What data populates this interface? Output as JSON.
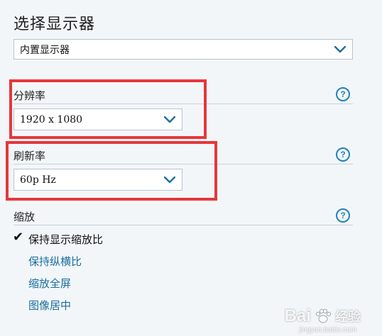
{
  "page": {
    "title": "选择显示器"
  },
  "display_select": {
    "value": "内置显示器"
  },
  "resolution": {
    "label": "分辨率",
    "value": "1920 x 1080"
  },
  "refresh_rate": {
    "label": "刷新率",
    "value": "60p Hz"
  },
  "scaling": {
    "label": "缩放",
    "options": [
      {
        "label": "保持显示缩放比",
        "selected": true
      },
      {
        "label": "保持纵横比",
        "selected": false
      },
      {
        "label": "缩放全屏",
        "selected": false
      },
      {
        "label": "图像居中",
        "selected": false
      }
    ]
  },
  "help_icon_text": "?",
  "check_mark": "✔",
  "watermark": {
    "brand": "Bai",
    "brand_cn": "经验",
    "url": "jingyan.baidu.com"
  },
  "colors": {
    "accent": "#1f83b8",
    "highlight_box": "#e8363b",
    "background": "#f3f6f9"
  }
}
